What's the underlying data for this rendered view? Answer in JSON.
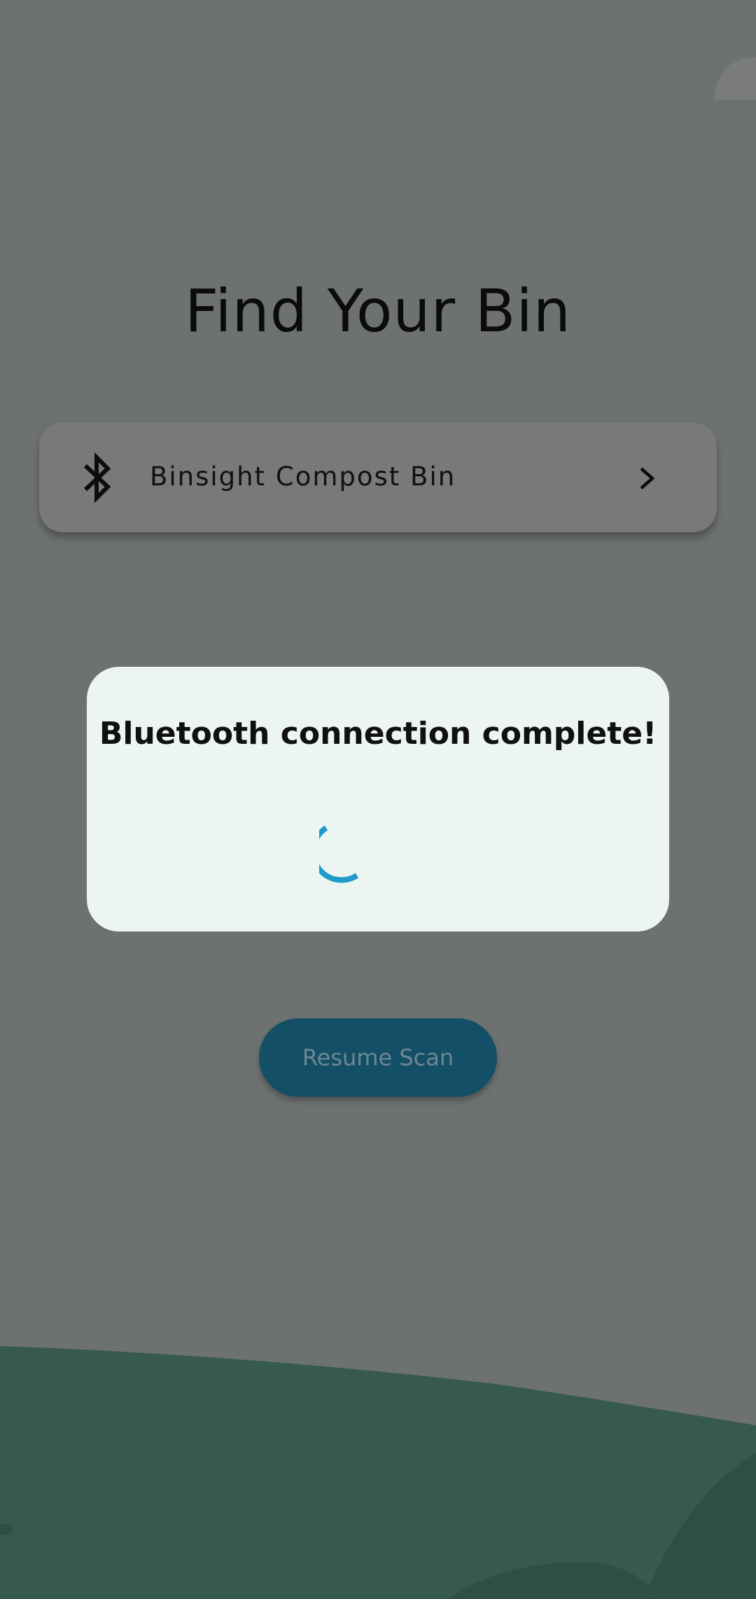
{
  "screen": {
    "title": "Find Your Bin"
  },
  "device_list": {
    "items": [
      {
        "name": "Binsight Compost Bin",
        "icon": "bluetooth-icon",
        "action_icon": "chevron-right-icon"
      }
    ]
  },
  "dialog": {
    "title": "Bluetooth connection complete!",
    "indicator": "loading-spinner"
  },
  "actions": {
    "resume_label": "Resume Scan"
  },
  "colors": {
    "scrim_background": "#6d7170",
    "dialog_background": "#ecf5f2",
    "spinner": "#1f9acb",
    "button_background": "#134f66",
    "hill_dark": "#2f4f44",
    "hill_light": "#365a4c"
  }
}
